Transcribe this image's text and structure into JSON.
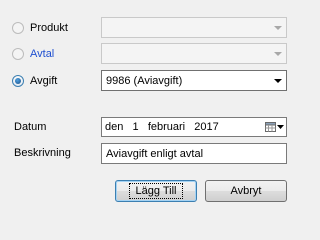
{
  "options": [
    {
      "label": "Produkt",
      "selected": false,
      "enabled": false,
      "combo_value": "",
      "combo_enabled": false
    },
    {
      "label": "Avtal",
      "selected": false,
      "enabled": false,
      "combo_value": "",
      "combo_enabled": false
    },
    {
      "label": "Avgift",
      "selected": true,
      "enabled": true,
      "combo_value": "9986 (Aviavgift)",
      "combo_enabled": true
    }
  ],
  "date": {
    "label": "Datum",
    "weekday": "den",
    "day": "1",
    "month": "februari",
    "year": "2017"
  },
  "description": {
    "label": "Beskrivning",
    "value": "Aviavgift enligt avtal"
  },
  "buttons": {
    "add_label": "Lägg Till",
    "cancel_label": "Avbryt"
  },
  "colors": {
    "avtal_label": "#1f4fd0",
    "default_button_border": "#3c7fb1"
  }
}
